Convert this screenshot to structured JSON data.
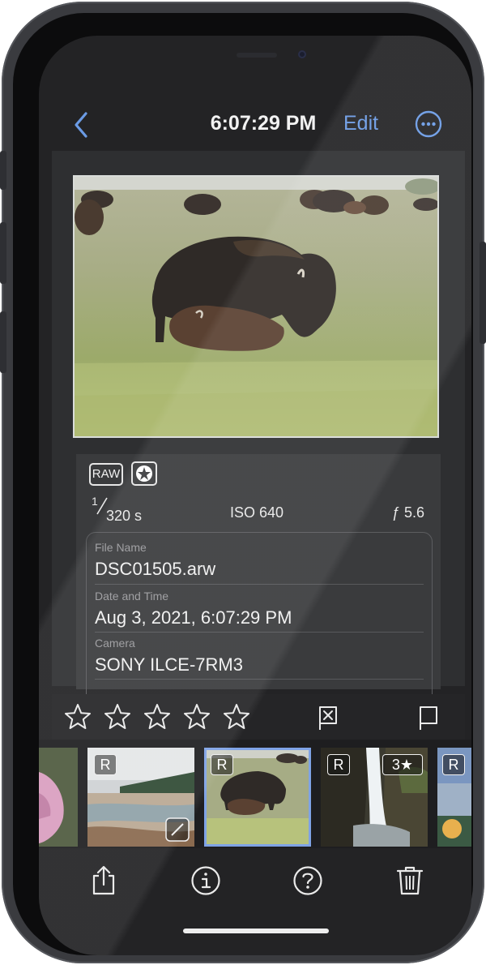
{
  "nav": {
    "time": "6:07:29 PM",
    "edit_label": "Edit"
  },
  "photo": {
    "format_badge": "RAW",
    "shutter_numerator": "1",
    "shutter_denominator": "320 s",
    "iso": "ISO 640",
    "aperture": "ƒ 5.6"
  },
  "details": {
    "file_name_label": "File Name",
    "file_name": "DSC01505.arw",
    "date_label": "Date and Time",
    "date": "Aug 3, 2021, 6:07:29 PM",
    "camera_label": "Camera",
    "camera": "SONY ILCE-7RM3"
  },
  "rating": {
    "stars": 0,
    "max_stars": 5
  },
  "filmstrip": {
    "raw_badge": "R",
    "rating_badge": "3★"
  },
  "colors": {
    "accent": "#6b9be5",
    "background": "#232325",
    "selected_border": "#7fa3e6"
  },
  "icons": [
    "back-chevron-icon",
    "more-ellipsis-icon",
    "star-outline-icon",
    "reject-flag-icon",
    "flag-icon",
    "share-icon",
    "info-icon",
    "help-icon",
    "trash-icon"
  ]
}
